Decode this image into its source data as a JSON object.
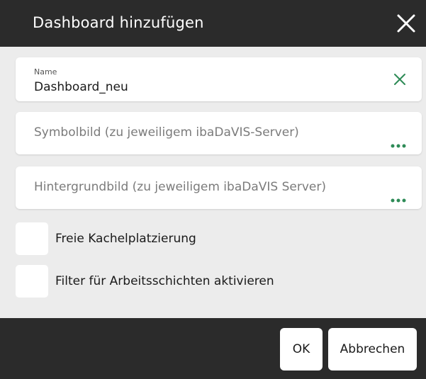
{
  "dialog": {
    "title": "Dashboard hinzufügen",
    "close_icon": "close-icon"
  },
  "fields": {
    "name": {
      "label": "Name",
      "value": "Dashboard_neu",
      "clear_icon": "clear-icon",
      "accent_color": "#2e8b57"
    },
    "symbol": {
      "placeholder": "Symbolbild (zu jeweiligem ibaDaVIS-Server)",
      "browse_icon": "more-dots-icon"
    },
    "background": {
      "placeholder": "Hintergrundbild (zu jeweiligem ibaDaVIS Server)",
      "browse_icon": "more-dots-icon"
    }
  },
  "options": [
    {
      "label": "Freie Kachelplatzierung",
      "checked": false
    },
    {
      "label": "Filter für Arbeitsschichten aktivieren",
      "checked": false
    }
  ],
  "buttons": {
    "ok": "OK",
    "cancel": "Abbrechen"
  },
  "colors": {
    "header_bg": "#2b2b2b",
    "body_bg": "#ececec",
    "accent": "#2e8b57"
  }
}
